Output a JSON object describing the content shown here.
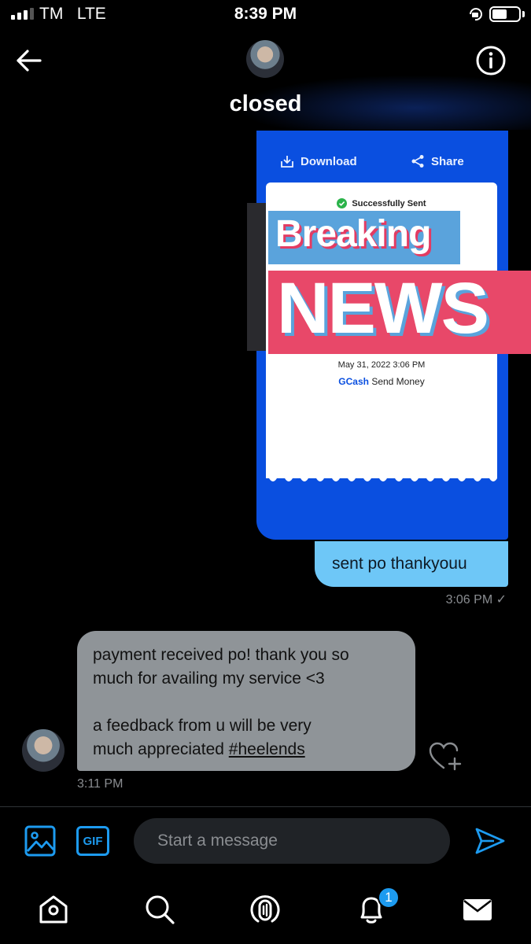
{
  "status_bar": {
    "carrier": "TM",
    "network": "LTE",
    "time": "8:39 PM"
  },
  "header": {
    "title": "closed",
    "icons": {
      "back": "back-arrow-icon",
      "info": "info-icon"
    }
  },
  "messages": {
    "sent_image": {
      "download_label": "Download",
      "share_label": "Share",
      "status": "Successfully Sent",
      "overlay_line1": "Breaking",
      "overlay_line2": "NEWS",
      "date": "May 31, 2022 3:06 PM",
      "method_brand": "GCash",
      "method_label": "Send Money"
    },
    "sent_text": "sent po thankyouu",
    "sent_time": "3:06 PM ✓",
    "received": {
      "line1": "payment received po! thank you so",
      "line2": "much for availing my service <3",
      "line3": "a feedback from u will be very",
      "line4_prefix": "much appreciated ",
      "hashtag": "#heelends",
      "time": "3:11 PM"
    }
  },
  "composer": {
    "placeholder": "Start a message",
    "gif_label": "GIF"
  },
  "bottom_nav": {
    "notification_count": "1",
    "icons": [
      "home-icon",
      "search-icon",
      "spaces-icon",
      "notifications-icon",
      "messages-icon"
    ]
  },
  "colors": {
    "background": "#000000",
    "sent_bubble": "#6ec7f7",
    "received_bubble": "#8f9498",
    "accent": "#1d9bf0",
    "receipt_blue": "#0a4fe0"
  }
}
